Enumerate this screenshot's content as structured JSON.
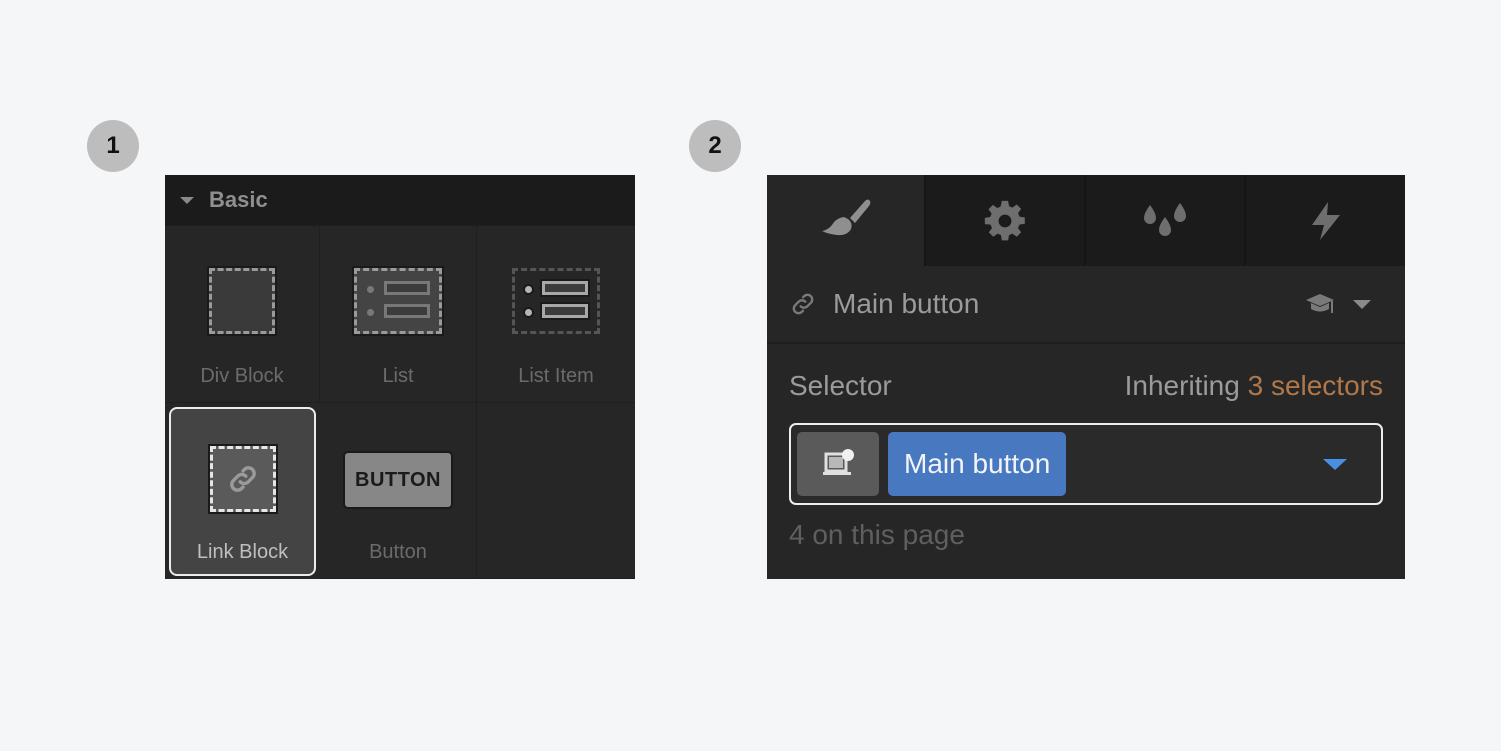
{
  "steps": {
    "first": "1",
    "second": "2"
  },
  "elements_panel": {
    "section_title": "Basic",
    "items": [
      {
        "label": "Div Block",
        "icon": "div-block-icon",
        "selected": false
      },
      {
        "label": "List",
        "icon": "list-icon",
        "selected": false
      },
      {
        "label": "List Item",
        "icon": "list-item-icon",
        "selected": false
      },
      {
        "label": "Link Block",
        "icon": "link-block-icon",
        "selected": true
      },
      {
        "label": "Button",
        "icon": "button-icon",
        "selected": false,
        "icon_text": "BUTTON"
      }
    ]
  },
  "style_panel": {
    "tabs": [
      {
        "name": "style",
        "icon": "paintbrush-icon",
        "active": true
      },
      {
        "name": "settings",
        "icon": "gear-icon",
        "active": false
      },
      {
        "name": "swatches",
        "icon": "droplets-icon",
        "active": false
      },
      {
        "name": "interactions",
        "icon": "lightning-icon",
        "active": false
      }
    ],
    "element_name": "Main button",
    "element_icon": "link-icon",
    "selector_label": "Selector",
    "inheriting_prefix": "Inheriting",
    "inheriting_count": "3 selectors",
    "selector_class": "Main button",
    "page_count": "4 on this page",
    "colors": {
      "accent_blue": "#4878c0",
      "caret_blue": "#4a90e2",
      "inherit_orange": "#b0774a"
    }
  }
}
